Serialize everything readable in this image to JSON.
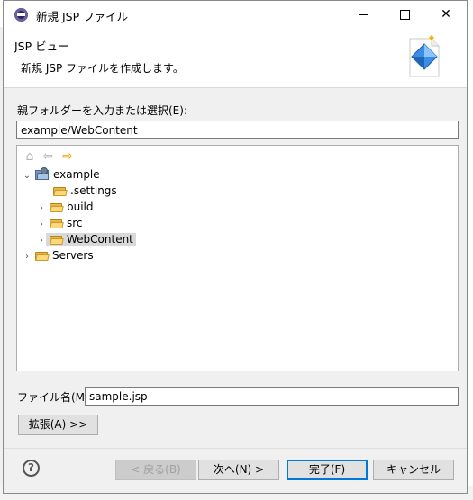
{
  "window": {
    "title": "新規 JSP ファイル",
    "controls": {
      "minimize": "minimize-icon",
      "maximize": "maximize-icon",
      "close": "close-icon"
    }
  },
  "header": {
    "title": "JSP ビュー",
    "description": "新規 JSP ファイルを作成します。"
  },
  "parent_folder": {
    "label": "親フォルダーを入力または選択(E):",
    "value": "example/WebContent"
  },
  "tree": {
    "nav_icons": [
      "home-icon",
      "back-arrow-icon",
      "forward-arrow-icon"
    ],
    "nodes": [
      {
        "label": "example",
        "expanded": true
      },
      {
        "label": ".settings"
      },
      {
        "label": "build",
        "expanded": false
      },
      {
        "label": "src",
        "expanded": false
      },
      {
        "label": "WebContent",
        "expanded": false,
        "selected": true
      },
      {
        "label": "Servers",
        "expanded": false
      }
    ]
  },
  "file_name": {
    "label": "ファイル名(M):",
    "value": "sample.jsp"
  },
  "buttons": {
    "advanced": "拡張(A) >>",
    "help": "?",
    "back": "< 戻る(B)",
    "next": "次へ(N) >",
    "finish": "完了(F)",
    "cancel": "キャンセル"
  },
  "colors": {
    "dialog_bg": "#f0f0f0",
    "selection": "#d9d9d9",
    "default_button_border": "#0078d7",
    "folder": "#e8b54a"
  }
}
